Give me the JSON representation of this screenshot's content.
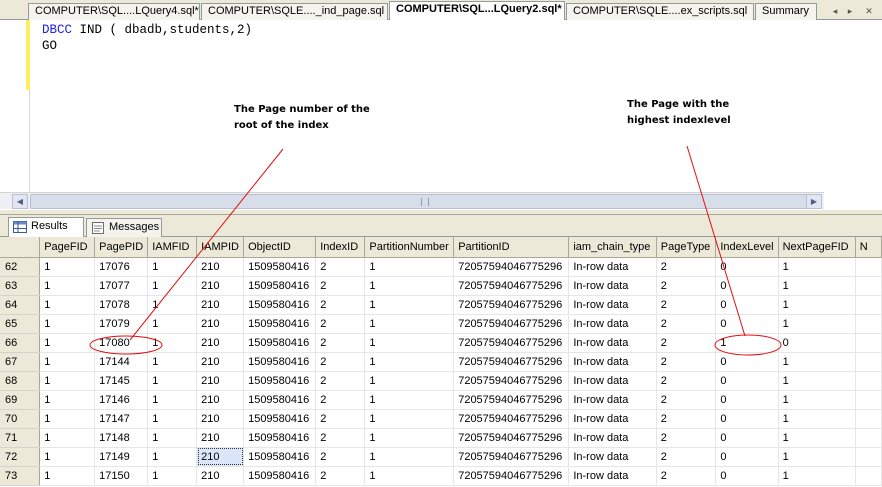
{
  "tabs": [
    {
      "label": "COMPUTER\\SQL....LQuery4.sql*",
      "active": false
    },
    {
      "label": "COMPUTER\\SQLE...._ind_page.sql",
      "active": false
    },
    {
      "label": "COMPUTER\\SQL...LQuery2.sql*",
      "active": true
    },
    {
      "label": "COMPUTER\\SQLE....ex_scripts.sql",
      "active": false
    },
    {
      "label": "Summary",
      "active": false
    }
  ],
  "editor": {
    "line1_keyword": "DBCC",
    "line1_rest": " IND ( dbadb,students,2)",
    "line2": "GO"
  },
  "annotations": {
    "left_line1": "The Page number of the",
    "left_line2": "root of the index",
    "right_line1": "The Page with the",
    "right_line2": "highest indexlevel"
  },
  "result_tabs": {
    "results": "Results",
    "messages": "Messages"
  },
  "grid": {
    "columns": [
      "PageFID",
      "PagePID",
      "IAMFID",
      "IAMPID",
      "ObjectID",
      "IndexID",
      "PartitionNumber",
      "PartitionID",
      "iam_chain_type",
      "PageType",
      "IndexLevel",
      "NextPageFID",
      "N"
    ],
    "rows": [
      {
        "num": "62",
        "cells": [
          "1",
          "17076",
          "1",
          "210",
          "1509580416",
          "2",
          "1",
          "72057594046775296",
          "In-row data",
          "2",
          "0",
          "1",
          ""
        ]
      },
      {
        "num": "63",
        "cells": [
          "1",
          "17077",
          "1",
          "210",
          "1509580416",
          "2",
          "1",
          "72057594046775296",
          "In-row data",
          "2",
          "0",
          "1",
          ""
        ]
      },
      {
        "num": "64",
        "cells": [
          "1",
          "17078",
          "1",
          "210",
          "1509580416",
          "2",
          "1",
          "72057594046775296",
          "In-row data",
          "2",
          "0",
          "1",
          ""
        ]
      },
      {
        "num": "65",
        "cells": [
          "1",
          "17079",
          "1",
          "210",
          "1509580416",
          "2",
          "1",
          "72057594046775296",
          "In-row data",
          "2",
          "0",
          "1",
          ""
        ]
      },
      {
        "num": "66",
        "cells": [
          "1",
          "17080",
          "1",
          "210",
          "1509580416",
          "2",
          "1",
          "72057594046775296",
          "In-row data",
          "2",
          "1",
          "0",
          ""
        ]
      },
      {
        "num": "67",
        "cells": [
          "1",
          "17144",
          "1",
          "210",
          "1509580416",
          "2",
          "1",
          "72057594046775296",
          "In-row data",
          "2",
          "0",
          "1",
          ""
        ]
      },
      {
        "num": "68",
        "cells": [
          "1",
          "17145",
          "1",
          "210",
          "1509580416",
          "2",
          "1",
          "72057594046775296",
          "In-row data",
          "2",
          "0",
          "1",
          ""
        ]
      },
      {
        "num": "69",
        "cells": [
          "1",
          "17146",
          "1",
          "210",
          "1509580416",
          "2",
          "1",
          "72057594046775296",
          "In-row data",
          "2",
          "0",
          "1",
          ""
        ]
      },
      {
        "num": "70",
        "cells": [
          "1",
          "17147",
          "1",
          "210",
          "1509580416",
          "2",
          "1",
          "72057594046775296",
          "In-row data",
          "2",
          "0",
          "1",
          ""
        ]
      },
      {
        "num": "71",
        "cells": [
          "1",
          "17148",
          "1",
          "210",
          "1509580416",
          "2",
          "1",
          "72057594046775296",
          "In-row data",
          "2",
          "0",
          "1",
          ""
        ]
      },
      {
        "num": "72",
        "cells": [
          "1",
          "17149",
          "1",
          "210",
          "1509580416",
          "2",
          "1",
          "72057594046775296",
          "In-row data",
          "2",
          "0",
          "1",
          ""
        ]
      },
      {
        "num": "73",
        "cells": [
          "1",
          "17150",
          "1",
          "210",
          "1509580416",
          "2",
          "1",
          "72057594046775296",
          "In-row data",
          "2",
          "0",
          "1",
          ""
        ]
      }
    ]
  },
  "colors": {
    "keyword": "#1e1ef0",
    "annotation_ink": "#e01010",
    "chrome": "#ece9d8"
  }
}
